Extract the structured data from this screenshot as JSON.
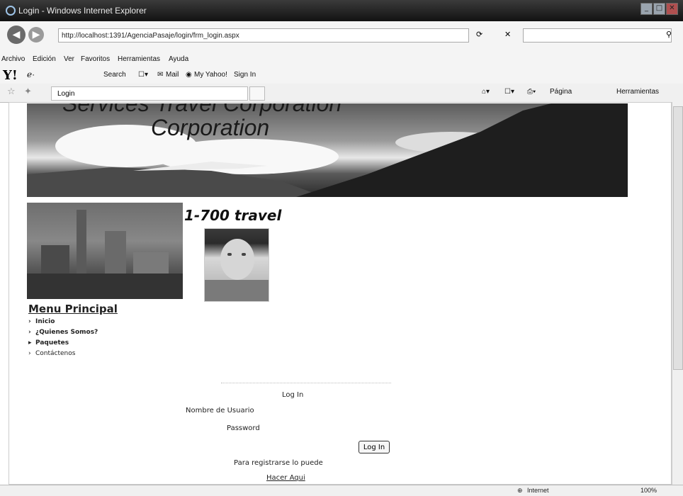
{
  "window": {
    "title": "Login - Windows Internet Explorer",
    "url": "http://localhost:1391/AgenciaPasaje/login/frm_login.aspx"
  },
  "menu": [
    "Archivo",
    "Edición",
    "Ver",
    "Favoritos",
    "Herramientas",
    "Ayuda"
  ],
  "yahoo_bar": {
    "search_label": "Search",
    "mail_label": "Mail",
    "myyahoo_label": "My Yahoo!",
    "signin_label": "Sign In"
  },
  "tab": {
    "label": "Login"
  },
  "commands": {
    "pagina": "Página",
    "herramientas": "Herramientas"
  },
  "page": {
    "banner_title": "Services Travel Corporation",
    "banner_line2": "Corporation",
    "slogan": "1-700 travel",
    "menu_title": "Menu Principal",
    "menu_items": [
      "Inicio",
      "¿Quienes Somos?",
      "Paquetes",
      "Contáctenos"
    ],
    "login": {
      "title": "Log In",
      "username_label": "Nombre de Usuario",
      "password_label": "Password",
      "button_label": "Log In",
      "register_text": "Para registrarse lo puede",
      "register_link": "Hacer Aqui"
    }
  },
  "status": {
    "zone": "Internet",
    "zoom": "100%"
  },
  "colors": {
    "titlebar": "#1c1c1c",
    "chrome": "#f4f4f4"
  }
}
